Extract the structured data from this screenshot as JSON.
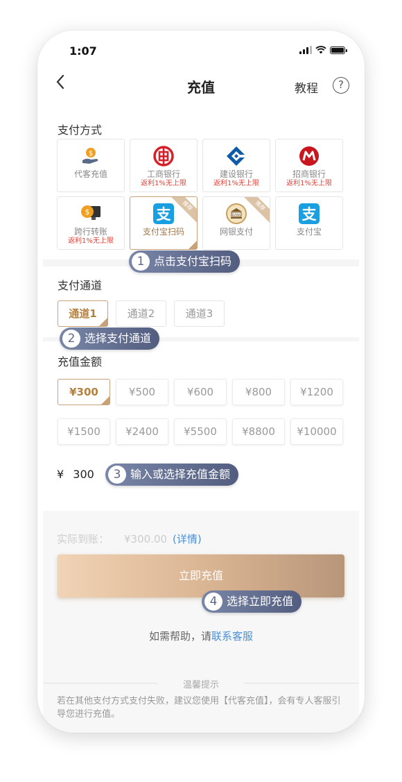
{
  "status_bar": {
    "time": "1:07"
  },
  "nav": {
    "back_icon": "chevron-left-icon",
    "title": "充值",
    "tutorial": "教程",
    "help_symbol": "?"
  },
  "payment_section": {
    "title": "支付方式",
    "methods": [
      {
        "label": "代客充值",
        "sub": "",
        "icon": "agent-coin-hand-icon",
        "color": "#f0a020"
      },
      {
        "label": "工商银行",
        "sub": "返利1%无上限",
        "icon": "icbc-logo-icon",
        "color": "#d6202a"
      },
      {
        "label": "建设银行",
        "sub": "返利1%无上限",
        "icon": "ccb-logo-icon",
        "color": "#0f5ba5"
      },
      {
        "label": "招商银行",
        "sub": "返利1%无上限",
        "icon": "cmb-logo-icon",
        "color": "#c8161e"
      },
      {
        "label": "跨行转账",
        "sub": "返利1%无上限",
        "icon": "coin-monitor-icon",
        "color": "#f0a020"
      },
      {
        "label": "支付宝扫码",
        "sub": "",
        "icon": "alipay-icon",
        "color": "#1a9fe0",
        "selected": true,
        "badge": "推荐"
      },
      {
        "label": "网银支付",
        "sub": "",
        "icon": "bank-icon",
        "color": "#c8a05a",
        "badge": "推荐"
      },
      {
        "label": "支付宝",
        "sub": "",
        "icon": "alipay-icon",
        "color": "#1a9fe0"
      }
    ]
  },
  "channel_section": {
    "title": "支付通道",
    "channels": [
      "通道1",
      "通道2",
      "通道3"
    ],
    "selected_index": 0
  },
  "amount_section": {
    "title": "充值金额",
    "amounts": [
      "¥300",
      "¥500",
      "¥600",
      "¥800",
      "¥1200",
      "¥1500",
      "¥2400",
      "¥5500",
      "¥8800",
      "¥10000"
    ],
    "selected_index": 0,
    "currency_symbol": "¥",
    "input_value": "300"
  },
  "summary": {
    "actual_label": "实际到账：",
    "actual_value": "¥300.00",
    "detail_link": "(详情)",
    "recharge_button": "立即充值",
    "help_prefix": "如需帮助，请",
    "help_link": "联系客服",
    "tips_title": "温馨提示",
    "tips_text": "若在其他支付方式支付失败，建议您使用【代客充值】，会有专人客服引导您进行充值。"
  },
  "callouts": [
    {
      "num": "1",
      "text": "点击支付宝扫码"
    },
    {
      "num": "2",
      "text": "选择支付通道"
    },
    {
      "num": "3",
      "text": "输入或选择充值金额"
    },
    {
      "num": "4",
      "text": "选择立即充值"
    }
  ],
  "colors": {
    "accent_gold": "#c7a178",
    "link_blue": "#4a8fd6",
    "rebate_red": "#e2433b",
    "callout": "#5d6788"
  }
}
